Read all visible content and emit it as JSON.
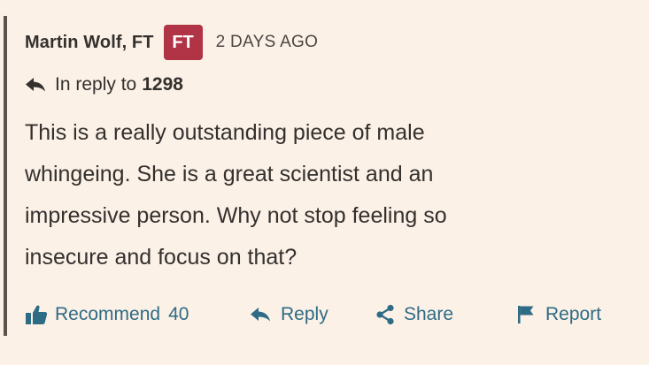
{
  "comment": {
    "author": "Martin Wolf, FT",
    "badge": "FT",
    "timestamp": "2 DAYS AGO",
    "reply_prefix": "In reply to",
    "reply_to_number": "1298",
    "body_lines": [
      "This is a really outstanding piece of male",
      "whingeing. She is a great scientist and an",
      "impressive person. Why not stop feeling so",
      "insecure and focus on that?"
    ]
  },
  "actions": {
    "recommend_label": "Recommend",
    "recommend_count": "40",
    "reply_label": "Reply",
    "share_label": "Share",
    "report_label": "Report"
  },
  "icons": {
    "reply_to": "reply-arrow-icon",
    "recommend": "thumbs-up-icon",
    "reply": "reply-arrow-icon",
    "share": "share-icon",
    "report": "flag-icon"
  },
  "colors": {
    "background": "#fcf1e6",
    "badge": "#b03346",
    "action_link": "#2e6b85",
    "text": "#33302e",
    "rail": "#5a534e"
  }
}
